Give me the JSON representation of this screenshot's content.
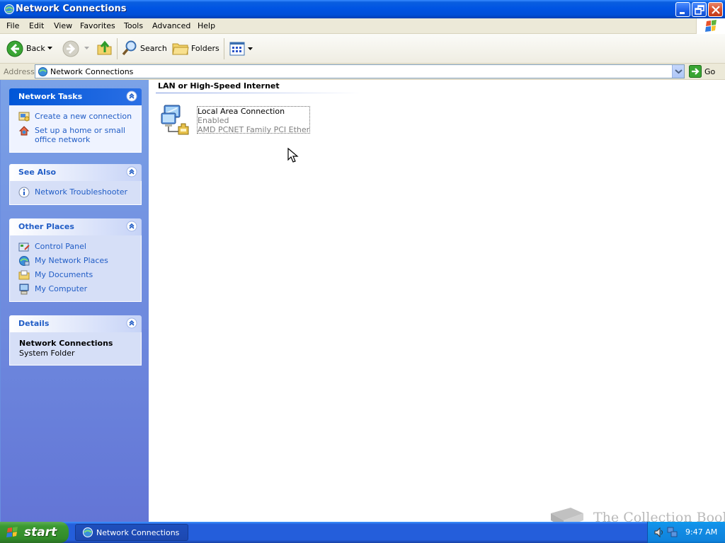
{
  "window": {
    "title": "Network Connections",
    "icon": "network-connections-icon"
  },
  "menubar": {
    "items": [
      "File",
      "Edit",
      "View",
      "Favorites",
      "Tools",
      "Advanced",
      "Help"
    ]
  },
  "toolbar": {
    "back_label": "Back",
    "search_label": "Search",
    "folders_label": "Folders"
  },
  "address": {
    "label": "Address",
    "value": "Network Connections",
    "go_label": "Go"
  },
  "taskpane": {
    "network_tasks": {
      "title": "Network Tasks",
      "items": [
        "Create a new connection",
        "Set up a home or small office network"
      ]
    },
    "see_also": {
      "title": "See Also",
      "items": [
        "Network Troubleshooter"
      ]
    },
    "other_places": {
      "title": "Other Places",
      "items": [
        "Control Panel",
        "My Network Places",
        "My Documents",
        "My Computer"
      ]
    },
    "details": {
      "title": "Details",
      "name": "Network Connections",
      "type": "System Folder"
    }
  },
  "content": {
    "group_title": "LAN or High-Speed Internet",
    "connection": {
      "name": "Local Area Connection",
      "status": "Enabled",
      "device": "AMD PCNET Family PCI Ethern..."
    }
  },
  "watermark": {
    "text": "The Collection Book"
  },
  "taskbar": {
    "start_label": "start",
    "task_button_label": "Network Connections",
    "clock": "9:47 AM"
  },
  "colors": {
    "titlebar": "#0054e3",
    "taskpane": "#6f8fe0",
    "link": "#215dc6",
    "start": "#3c9a32"
  }
}
